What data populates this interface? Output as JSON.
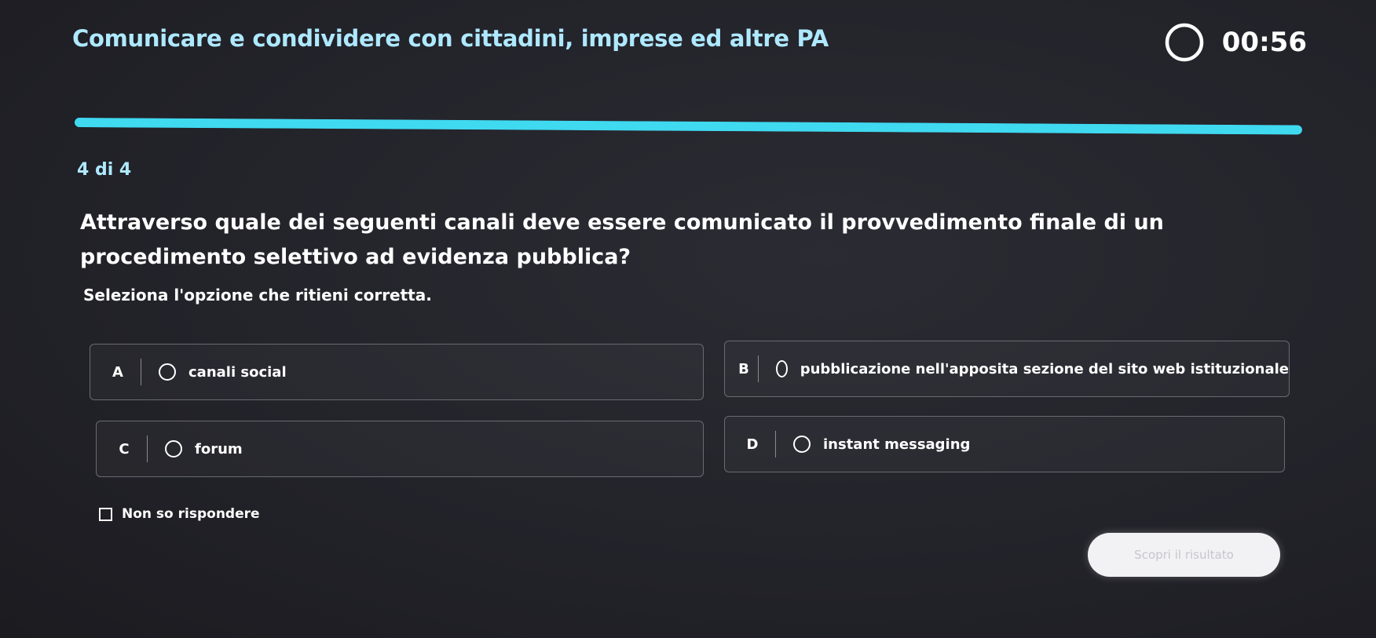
{
  "header": {
    "title": "Comunicare e condividere con cittadini, imprese ed altre PA",
    "timer": "00:56",
    "timer_icon": "timer-ring-icon"
  },
  "progress": {
    "fraction": 1.0,
    "color": "#3fd9f0"
  },
  "quiz": {
    "counter": "4 di 4",
    "question": "Attraverso quale dei seguenti canali deve essere comunicato il provvedimento finale di un procedimento selettivo ad evidenza pubblica?",
    "instruction": "Seleziona l'opzione che ritieni corretta.",
    "options": [
      {
        "letter": "A",
        "label": "canali social"
      },
      {
        "letter": "B",
        "label": "pubblicazione nell'apposita sezione del sito web istituzionale"
      },
      {
        "letter": "C",
        "label": "forum"
      },
      {
        "letter": "D",
        "label": "instant messaging"
      }
    ],
    "dont_know_label": "Non so rispondere",
    "submit_label": "Scopri il risultato"
  },
  "colors": {
    "accent": "#3fd9f0",
    "title_color": "#aee9ff",
    "background": "#23232a"
  }
}
